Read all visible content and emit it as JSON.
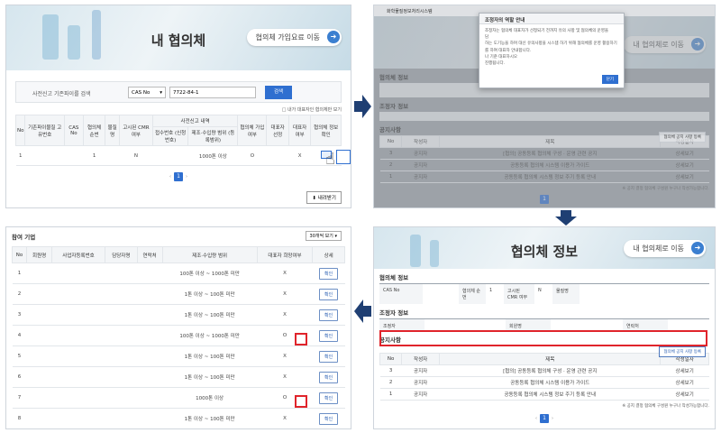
{
  "panel1": {
    "hero_title": "내 협의체",
    "hero_button": "협의체 가입요료 이동",
    "search_label": "사전신고 기존파이를 검색",
    "select_value": "CAS No",
    "input_value": "7722-84-1",
    "search_button": "검색",
    "option_text": "□ 내가 대표자인 협의체만 보기",
    "columns": [
      "No",
      "기존파이물질 고유번호",
      "CAS No",
      "협의체 순번",
      "물질명",
      "고시된 CMR 여부",
      "접수번호 (신청번호)",
      "제조·수입량 범위 (등록범위)",
      "협의체 가입여부",
      "대표자 선정",
      "대표자 여부",
      "협의체 정보확인"
    ],
    "group_header": "사전신고 내역",
    "row": [
      "1",
      "",
      "",
      "1",
      "",
      "N",
      "",
      "1000톤 이상",
      "O",
      "",
      "X",
      ""
    ],
    "page": "1",
    "pager_prev": "‹",
    "pager_next": "›",
    "download": "내려받기"
  },
  "panel2": {
    "topbar_text": "화학물질정보처리시스템",
    "hero_title": "협의체 정보",
    "hero_button": "내 협의체로 이동",
    "modal_title": "조정자의 역할 안내",
    "modal_lines": [
      "조정자는 협의체 대표자가 선정되기 전까지 유의 사항 및 협의체의 운영을",
      "담",
      "하는 도기능을 하며 대신 유의사항을 시스템 하기 위해 협의체를 운영 활용하기를 하여 대표자 안내합니다.",
      "나 기준 대표하시오",
      "진행됩니다."
    ],
    "modal_button": "닫기",
    "section1": "협의체 정보",
    "section2": "조정자 정보",
    "section3": "공지사항",
    "notice_button": "협의체 공지 사항 등록",
    "notice_cols": [
      "No",
      "작성자",
      "제목",
      "작성일자"
    ],
    "notices": [
      [
        "3",
        "공지자",
        "[협의] 공동등록 협의체 구성 · 운영 관련 공지",
        "상세보기"
      ],
      [
        "2",
        "공지자",
        "공동등록 협의체 시스템 이용가 가이드",
        "상세보기"
      ],
      [
        "1",
        "공지자",
        "공동등록 협의체 시스템 정보 주기 등록 안내",
        "상세보기"
      ]
    ],
    "footnote": "※ 공지 결정 협의체 구성원 누구나 작성가능합니다.",
    "page": "1"
  },
  "panel3": {
    "title": "참여 기업",
    "select_value": "30개씩 보기",
    "columns": [
      "No",
      "회원명",
      "사업자등록번호",
      "담당자명",
      "연락처",
      "제조·수입량 범위",
      "대표자 희망여부",
      "상세"
    ],
    "rows": [
      [
        "1",
        "",
        "",
        "",
        "",
        "100톤 이상 ~ 1000톤 미만",
        "X",
        "확인"
      ],
      [
        "2",
        "",
        "",
        "",
        "",
        "1톤 이상 ~ 100톤 미만",
        "X",
        "확인"
      ],
      [
        "3",
        "",
        "",
        "",
        "",
        "1톤 이상 ~ 100톤 미만",
        "X",
        "확인"
      ],
      [
        "4",
        "",
        "",
        "",
        "",
        "100톤 이상 ~ 1000톤 미만",
        "O",
        "확인"
      ],
      [
        "5",
        "",
        "",
        "",
        "",
        "1톤 이상 ~ 100톤 미만",
        "X",
        "확인"
      ],
      [
        "6",
        "",
        "",
        "",
        "",
        "1톤 이상 ~ 100톤 미만",
        "X",
        "확인"
      ],
      [
        "7",
        "",
        "",
        "",
        "",
        "1000톤 이상",
        "O",
        "확인"
      ],
      [
        "8",
        "",
        "",
        "",
        "",
        "1톤 이상 ~ 100톤 미만",
        "X",
        "확인"
      ]
    ]
  },
  "panel4": {
    "hero_title": "협의체 정보",
    "hero_button": "내 협의체로 이동",
    "section1": "협의체 정보",
    "info_labels": [
      "CAS No",
      "협의체 순번",
      "1",
      "고시된 CMR 여부",
      "N",
      "물질명"
    ],
    "section2": "조정자 정보",
    "coord_labels": [
      "조정자",
      "회원명",
      "연락처"
    ],
    "section3": "공지사항",
    "notice_button": "협의체 공지 사항 등록",
    "notice_cols": [
      "No",
      "작성자",
      "제목",
      "작성일자"
    ],
    "notices": [
      [
        "3",
        "공지자",
        "[협의] 공동등록 협의체 구성 · 운영 관련 공지",
        "상세보기"
      ],
      [
        "2",
        "공지자",
        "공동등록 협의체 시스템 이용가 가이드",
        "상세보기"
      ],
      [
        "1",
        "공지자",
        "공동등록 협의체 시스템 정보 주기 등록 안내",
        "상세보기"
      ]
    ],
    "footnote": "※ 공지 결정 협의체 구성원 누구나 작성가능합니다.",
    "page": "1"
  },
  "colors": {
    "accent": "#2f6fd0",
    "highlight": "#e0242b",
    "flow_arrow": "#1f3f73"
  }
}
